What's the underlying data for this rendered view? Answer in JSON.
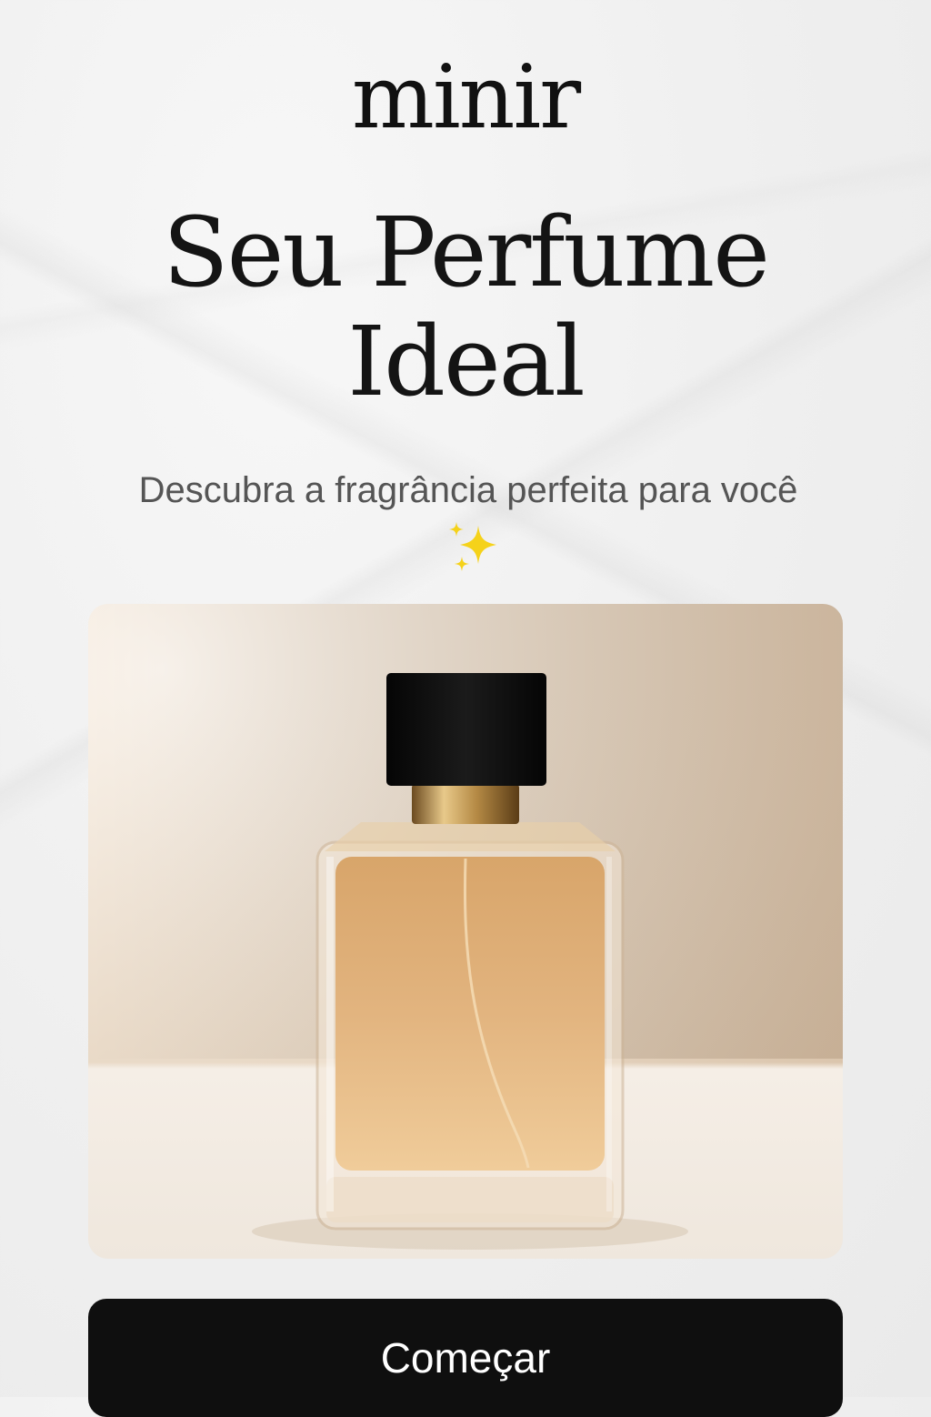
{
  "brand": {
    "logo_text": "minir"
  },
  "hero": {
    "title_line1": "Seu Perfume",
    "title_line2": "Ideal",
    "subtitle": "Descubra a fragrância perfeita para você",
    "sparkle_emoji": "✨"
  },
  "product_image": {
    "icon": "perfume-bottle-icon"
  },
  "cta": {
    "label": "Começar"
  },
  "colors": {
    "cta_background": "#0f0f0f",
    "cta_text": "#ffffff",
    "sparkle": "#f5d21a",
    "page_background": "#efefef"
  }
}
